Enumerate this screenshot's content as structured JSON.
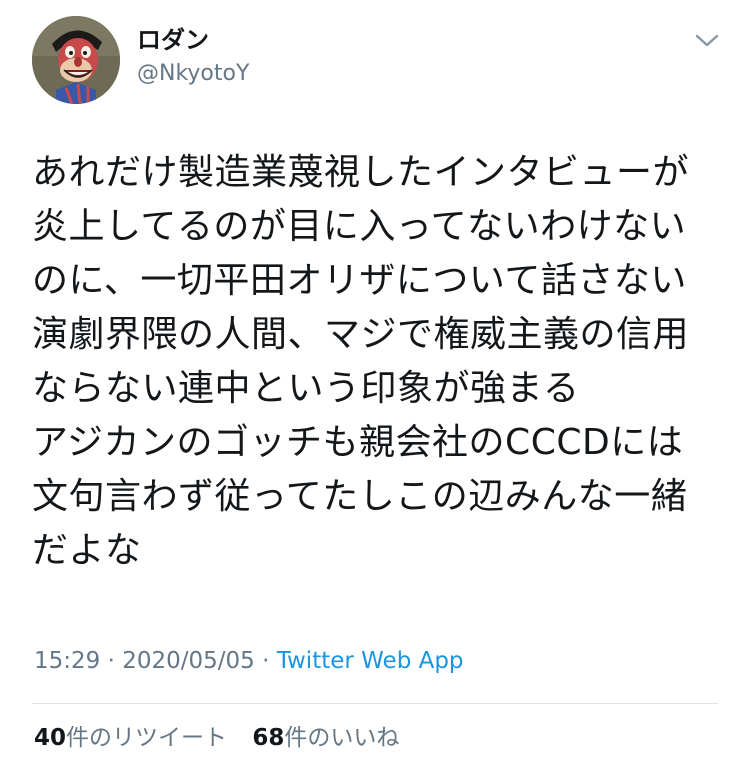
{
  "author": {
    "avatar_icon": "cartoon-avatar-icon",
    "display_name": "ロダン",
    "handle": "@NkyotoY"
  },
  "menu": {
    "icon": "chevron-down-icon"
  },
  "tweet": {
    "lines": [
      "あれだけ製造業蔑視したインタビューが",
      "炎上してるのが目に入ってないわけない",
      "のに、一切平田オリザについて話さない",
      "演劇界隈の人間、マジで権威主義の信用",
      "ならない連中という印象が強まる",
      "アジカンのゴッチも親会社のCCCDには",
      "文句言わず従ってたしこの辺みんな一緒",
      "だよな"
    ]
  },
  "meta": {
    "time": "15:29",
    "separator": " · ",
    "date": "2020/05/05",
    "source": "Twitter Web App"
  },
  "stats": {
    "retweets_count": "40",
    "retweets_label": "件のリツイート",
    "likes_count": "68",
    "likes_label": "件のいいね"
  },
  "colors": {
    "text": "#14171a",
    "secondary": "#657786",
    "link": "#1b95e0",
    "divider": "#dfe3e6"
  }
}
